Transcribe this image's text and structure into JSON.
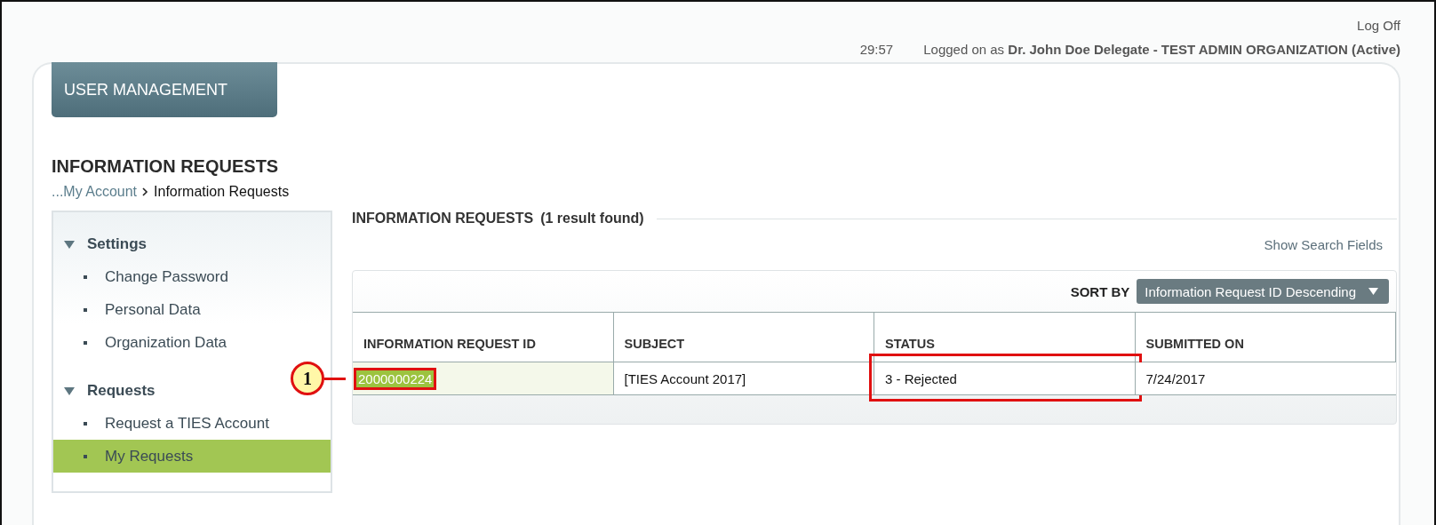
{
  "header": {
    "log_off": "Log Off",
    "timer": "29:57",
    "logged_on": "Logged on as **Dr. John Doe Delegate - TEST ADMIN ORGANIZATION (Active)**"
  },
  "module_tab": "USER MANAGEMENT",
  "page_title": "INFORMATION REQUESTS",
  "breadcrumb": [
    {
      "label": "...My Account",
      "kind": "link"
    },
    {
      "label": "Information Requests",
      "kind": "current"
    }
  ],
  "sidebar": {
    "groups": [
      {
        "title": "Settings",
        "expanded": true,
        "items": [
          {
            "label": "Change Password",
            "selected": false
          },
          {
            "label": "Personal Data",
            "selected": false
          },
          {
            "label": "Organization Data",
            "selected": false
          }
        ]
      },
      {
        "title": "Requests",
        "expanded": true,
        "items": [
          {
            "label": "Request a TIES Account",
            "selected": false
          },
          {
            "label": "My Requests",
            "selected": true
          }
        ]
      }
    ]
  },
  "results": {
    "title": "INFORMATION REQUESTS",
    "count": "(1 result found)",
    "show_search_fields": "Show Search Fields",
    "sort_label": "SORT BY",
    "sort_value": "Information Request ID Descending"
  },
  "table": {
    "columns": [
      "INFORMATION REQUEST ID",
      "SUBJECT",
      "STATUS",
      "SUBMITTED ON"
    ],
    "rows": [
      {
        "cells": [
          {
            "text": "2000000224",
            "kind": "link",
            "highlighted": true,
            "callout": "1"
          },
          {
            "text": "[TIES Account 2017]",
            "kind": "text",
            "highlighted": false
          },
          {
            "text": "3 - Rejected",
            "kind": "text",
            "highlighted": true
          },
          {
            "text": "7/24/2017",
            "kind": "text",
            "highlighted": false
          }
        ]
      }
    ]
  }
}
